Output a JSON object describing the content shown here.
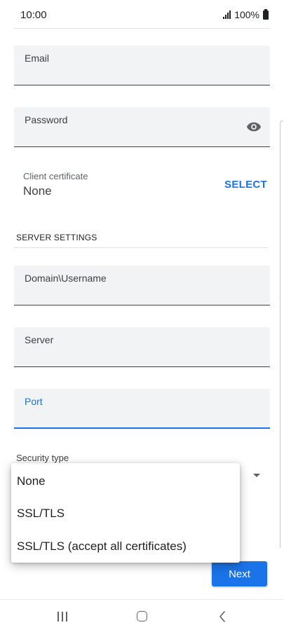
{
  "status_bar": {
    "time": "10:00",
    "battery_text": "100%"
  },
  "form": {
    "email_label": "Email",
    "password_label": "Password",
    "client_certificate_label": "Client certificate",
    "client_certificate_value": "None",
    "select_button": "SELECT",
    "server_settings_header": "SERVER SETTINGS",
    "domain_username_label": "Domain\\Username",
    "server_label": "Server",
    "port_label": "Port",
    "security_type_label": "Security type",
    "next_button": "Next"
  },
  "security_popup": {
    "options": [
      "None",
      "SSL/TLS",
      "SSL/TLS (accept all certificates)"
    ]
  },
  "colors": {
    "accent": "#1a73e8",
    "field_background": "#f1f3f4"
  },
  "icons": {
    "password": "eye-icon",
    "dropdown": "dropdown-arrow-icon",
    "nav": [
      "recents-icon",
      "home-icon",
      "back-icon"
    ]
  }
}
